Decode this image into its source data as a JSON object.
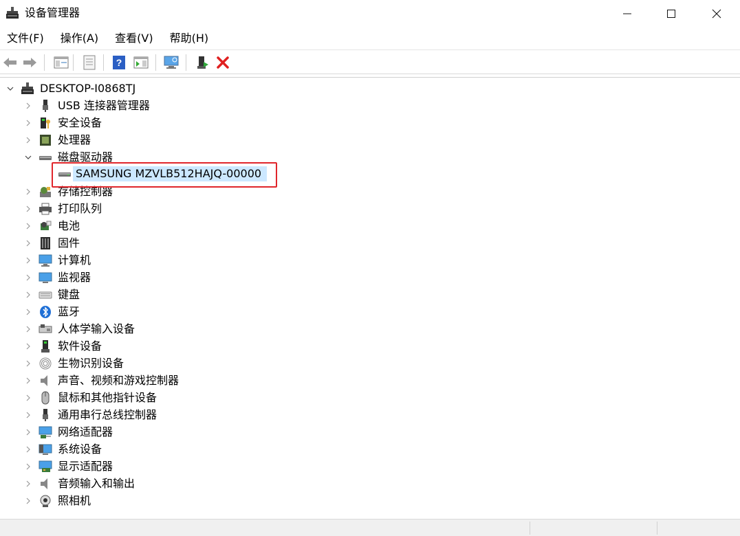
{
  "window": {
    "title": "设备管理器"
  },
  "menu": [
    "文件(F)",
    "操作(A)",
    "查看(V)",
    "帮助(H)"
  ],
  "tree": {
    "root": "DESKTOP-I0868TJ",
    "categories": [
      {
        "label": "USB 连接器管理器",
        "icon": "usb-icon"
      },
      {
        "label": "安全设备",
        "icon": "security-device-icon"
      },
      {
        "label": "处理器",
        "icon": "processor-icon"
      },
      {
        "label": "磁盘驱动器",
        "icon": "disk-drive-icon",
        "expanded": true,
        "children": [
          "SAMSUNG MZVLB512HAJQ-00000"
        ]
      },
      {
        "label": "存储控制器",
        "icon": "storage-controller-icon"
      },
      {
        "label": "打印队列",
        "icon": "printer-icon"
      },
      {
        "label": "电池",
        "icon": "battery-icon"
      },
      {
        "label": "固件",
        "icon": "firmware-icon"
      },
      {
        "label": "计算机",
        "icon": "computer-icon"
      },
      {
        "label": "监视器",
        "icon": "monitor-icon"
      },
      {
        "label": "键盘",
        "icon": "keyboard-icon"
      },
      {
        "label": "蓝牙",
        "icon": "bluetooth-icon"
      },
      {
        "label": "人体学输入设备",
        "icon": "hid-icon"
      },
      {
        "label": "软件设备",
        "icon": "software-device-icon"
      },
      {
        "label": "生物识别设备",
        "icon": "fingerprint-icon"
      },
      {
        "label": "声音、视频和游戏控制器",
        "icon": "speaker-icon"
      },
      {
        "label": "鼠标和其他指针设备",
        "icon": "mouse-icon"
      },
      {
        "label": "通用串行总线控制器",
        "icon": "usb-controller-icon"
      },
      {
        "label": "网络适配器",
        "icon": "network-adapter-icon"
      },
      {
        "label": "系统设备",
        "icon": "system-device-icon"
      },
      {
        "label": "显示适配器",
        "icon": "display-adapter-icon"
      },
      {
        "label": "音频输入和输出",
        "icon": "audio-io-icon"
      },
      {
        "label": "照相机",
        "icon": "camera-icon"
      }
    ]
  },
  "colors": {
    "selection": "#cce8ff",
    "highlight_box": "#e0252a"
  }
}
